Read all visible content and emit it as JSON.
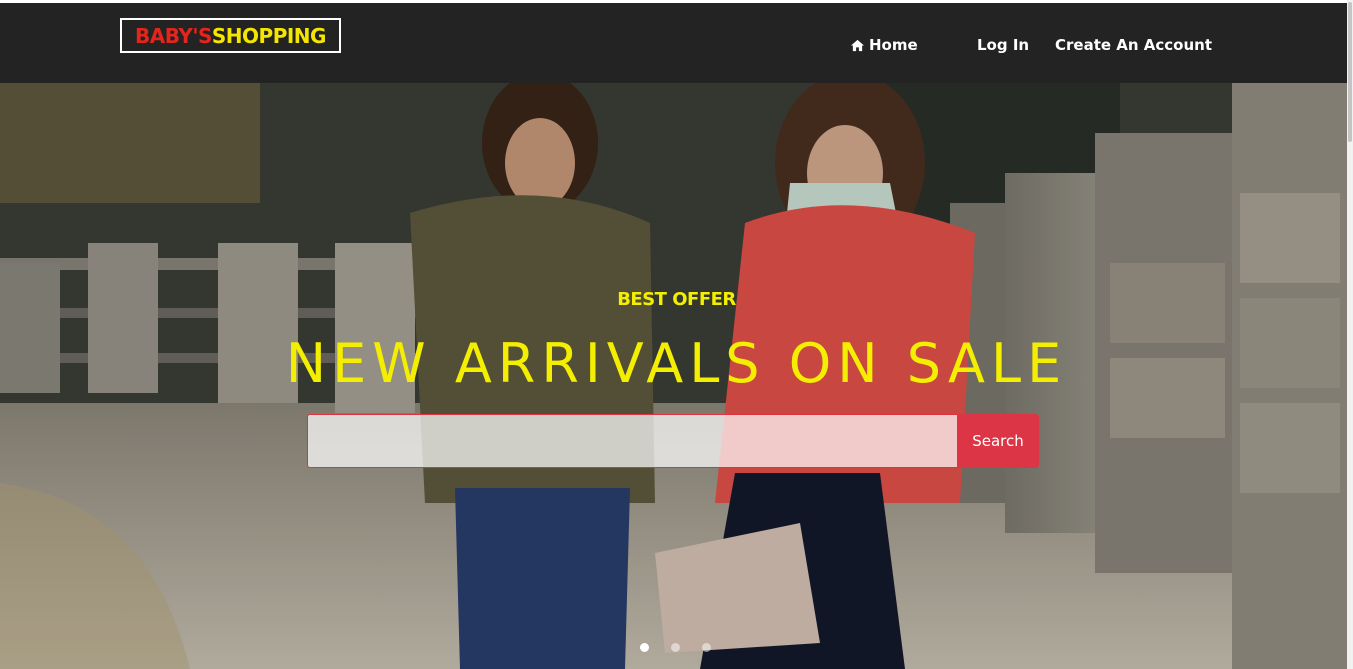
{
  "brand": {
    "part1": "BABY'S",
    "part2": "SHOPPING"
  },
  "nav": {
    "home_label": "Home",
    "login_label": "Log In",
    "create_label": "Create An Account"
  },
  "hero": {
    "offer_text": "BEST OFFER",
    "headline": "NEW ARRIVALS ON SALE",
    "search_placeholder": "",
    "search_value": "",
    "search_button": "Search",
    "slide_count": 3,
    "active_slide": 1
  },
  "colors": {
    "navbar_bg": "#232323",
    "brand_red": "#e5241b",
    "brand_yellow": "#f4e600",
    "headline_yellow": "#f4ee00",
    "search_button": "#dc3545"
  },
  "icons": {
    "home": "home-icon"
  }
}
